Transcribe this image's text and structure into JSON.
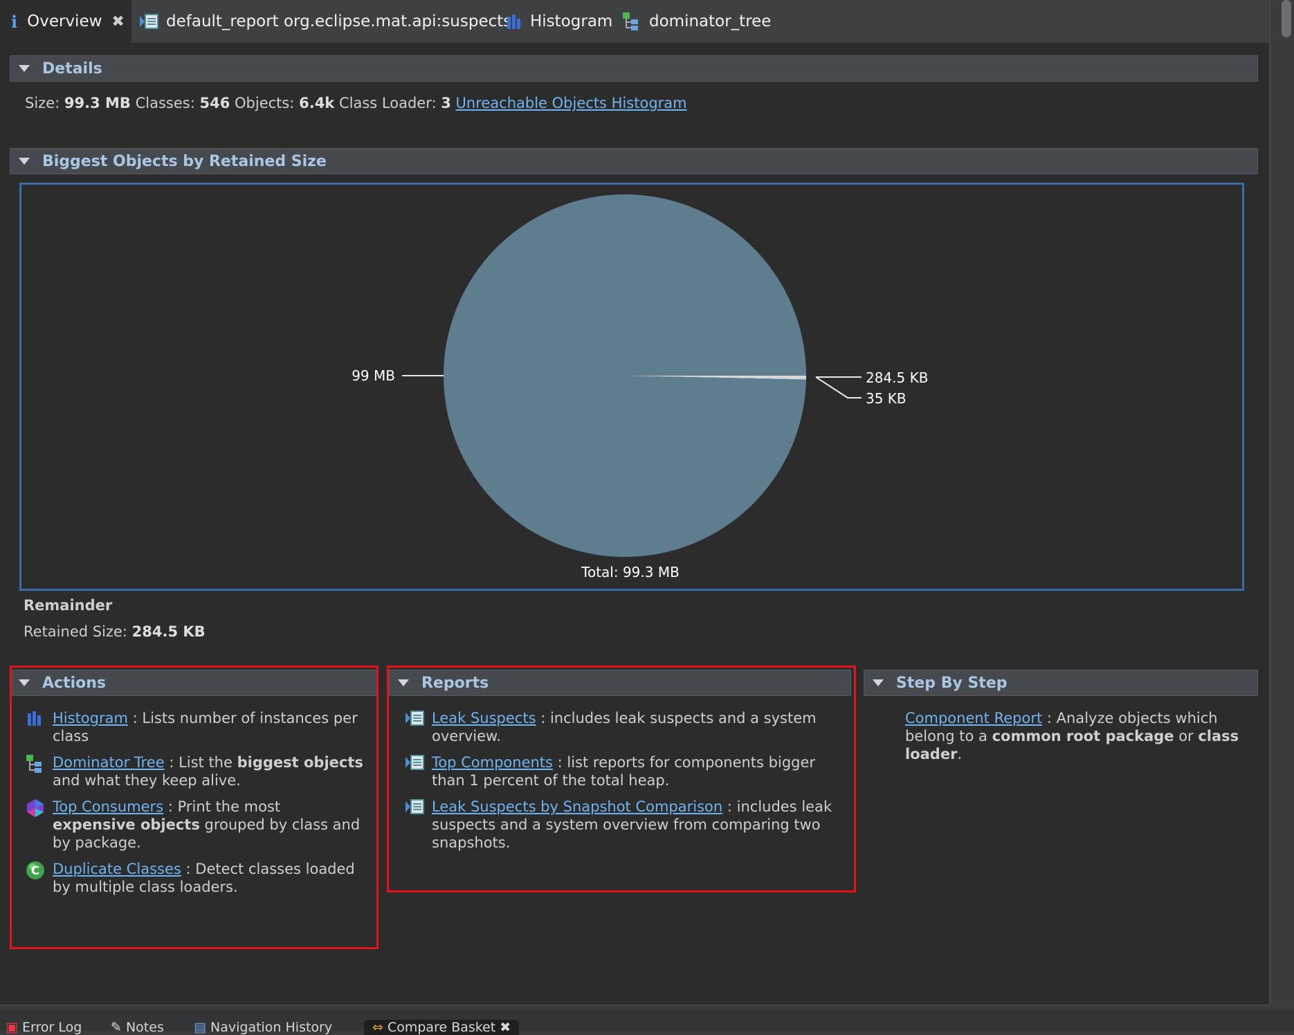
{
  "tabs": [
    {
      "label": "Overview",
      "icon": "info-icon",
      "active": true
    },
    {
      "label": "default_report  org.eclipse.mat.api:suspects",
      "icon": "report-icon"
    },
    {
      "label": "Histogram",
      "icon": "histogram-icon"
    },
    {
      "label": "dominator_tree",
      "icon": "dominator-tree-icon"
    }
  ],
  "details": {
    "header": "Details",
    "size_label": "Size:",
    "size_value": "99.3 MB",
    "classes_label": "Classes:",
    "classes_value": "546",
    "objects_label": "Objects:",
    "objects_value": "6.4k",
    "loader_label": "Class Loader:",
    "loader_value": "3",
    "link": "Unreachable Objects Histogram"
  },
  "biggest": {
    "header": "Biggest Objects by Retained Size",
    "remainder_title": "Remainder",
    "retained_label": "Retained Size:",
    "retained_value": "284.5 KB"
  },
  "chart_data": {
    "type": "pie",
    "title": "",
    "total_label": "Total: 99.3 MB",
    "slices": [
      {
        "label": "99 MB",
        "value": 99000,
        "color": "#5e7e8f"
      },
      {
        "label": "284.5 KB",
        "value": 284.5,
        "color": "#d9d9d9"
      },
      {
        "label": "35 KB",
        "value": 35,
        "color": "#eeeeee"
      }
    ]
  },
  "actions": {
    "header": "Actions",
    "items": [
      {
        "link": "Histogram",
        "text1": " : Lists number of instances per",
        "text2": "class",
        "icon": "histogram-icon"
      },
      {
        "link": "Dominator Tree",
        "text1": " : List the ",
        "bold1": "biggest objects",
        "text2": " and what they keep alive.",
        "icon": "dominator-tree-icon"
      },
      {
        "link": "Top Consumers",
        "text1": " : Print the most",
        "bold1": "expensive objects",
        "text2": " grouped by class and",
        "text3": "by package.",
        "icon": "top-consumers-icon"
      },
      {
        "link": "Duplicate Classes",
        "text1": " : Detect classes loaded",
        "text2": "by multiple class loaders.",
        "icon": "duplicate-classes-icon"
      }
    ]
  },
  "reports": {
    "header": "Reports",
    "items": [
      {
        "link": "Leak Suspects",
        "text1": " : includes leak suspects and a system",
        "text2": "overview."
      },
      {
        "link": "Top Components",
        "text1": " : list reports for components bigger",
        "text2": "than 1 percent of the total heap."
      },
      {
        "link": "Leak Suspects by Snapshot Comparison",
        "text1": " : includes leak",
        "text2": "suspects and a system overview from comparing two",
        "text3": "snapshots."
      }
    ]
  },
  "stepbystep": {
    "header": "Step By Step",
    "link": "Component Report",
    "text1": " : Analyze objects which",
    "text2a": "belong to a ",
    "bold1": "common root package",
    "text2b": " or ",
    "bold2": "class",
    "bold3": "loader",
    "text3": "."
  },
  "bottom_tabs": [
    "Error Log",
    "Notes",
    "Navigation History",
    "Compare Basket"
  ]
}
